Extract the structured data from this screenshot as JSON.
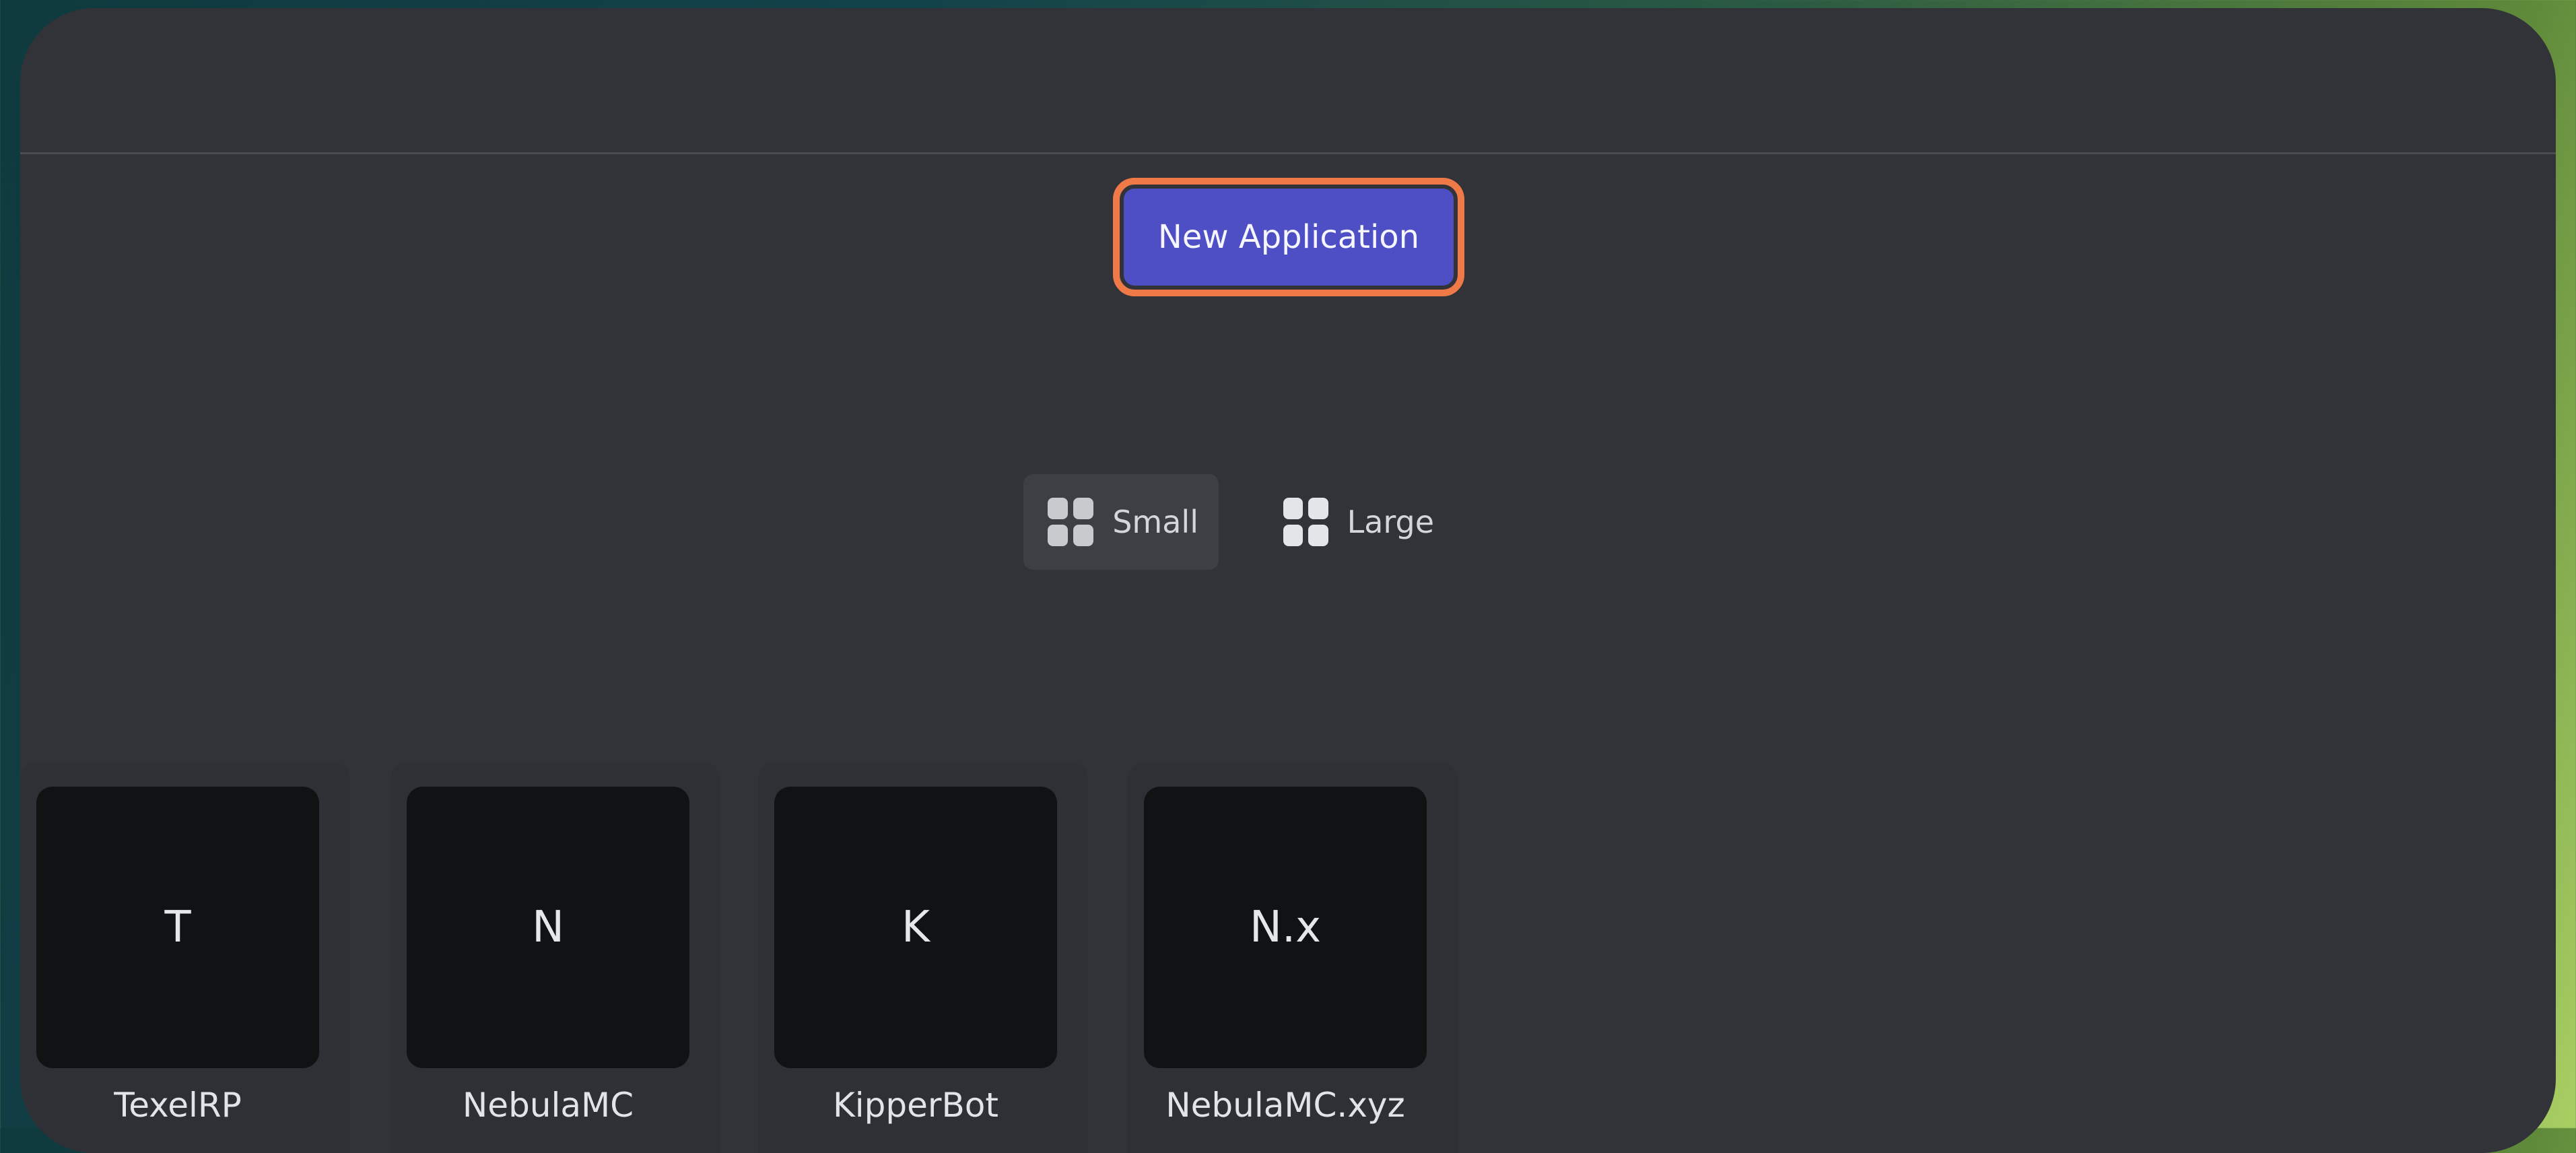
{
  "toolbar": {
    "new_application_label": "New Application"
  },
  "view_toggle": {
    "small_label": "Small",
    "large_label": "Large",
    "selected": "Small"
  },
  "applications": [
    {
      "initials": "T",
      "name": "TexelRP"
    },
    {
      "initials": "N",
      "name": "NebulaMC"
    },
    {
      "initials": "K",
      "name": "KipperBot"
    },
    {
      "initials": "N.x",
      "name": "NebulaMC.xyz"
    }
  ],
  "colors": {
    "primary_button": "#4e4fc4",
    "highlight_outline": "#f07a47",
    "panel_background": "#313338",
    "thumbnail_background": "#111214"
  },
  "icons": {
    "view_small": "grid-icon",
    "view_large": "grid-icon"
  }
}
